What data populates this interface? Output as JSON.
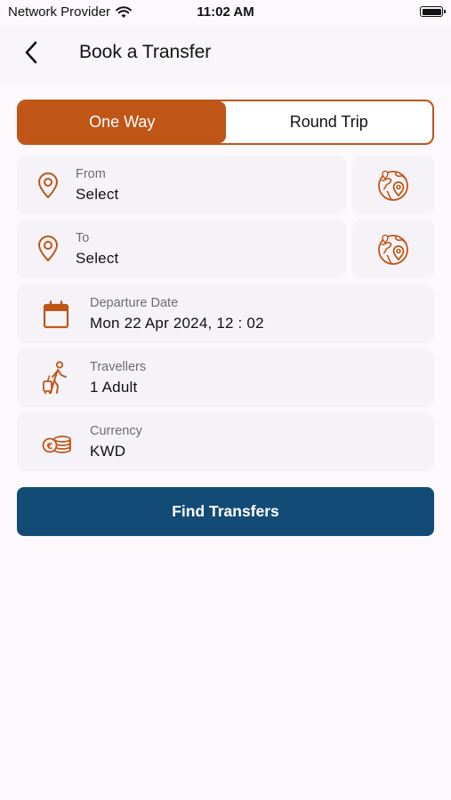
{
  "status_bar": {
    "carrier": "Network Provider",
    "time": "11:02 AM"
  },
  "header": {
    "title": "Book a Transfer",
    "back_icon": "chevron-left-icon"
  },
  "trip_type": {
    "options": [
      "One Way",
      "Round Trip"
    ],
    "selected": "One Way"
  },
  "form": {
    "from": {
      "label": "From",
      "value": "Select",
      "icon": "location-pin-icon",
      "map_icon": "globe-map-icon"
    },
    "to": {
      "label": "To",
      "value": "Select",
      "icon": "location-pin-icon",
      "map_icon": "globe-map-icon"
    },
    "departure": {
      "label": "Departure Date",
      "value": "Mon 22 Apr 2024, 12 : 02",
      "icon": "calendar-icon"
    },
    "travellers": {
      "label": "Travellers",
      "value": "1 Adult",
      "icon": "traveller-luggage-icon"
    },
    "currency": {
      "label": "Currency",
      "value": "KWD",
      "icon": "coins-icon"
    }
  },
  "actions": {
    "find_label": "Find Transfers"
  },
  "colors": {
    "accent": "#c05518",
    "primary_button": "#124b75",
    "card_bg": "#f6f3f8",
    "page_bg": "#fcf8fc"
  }
}
